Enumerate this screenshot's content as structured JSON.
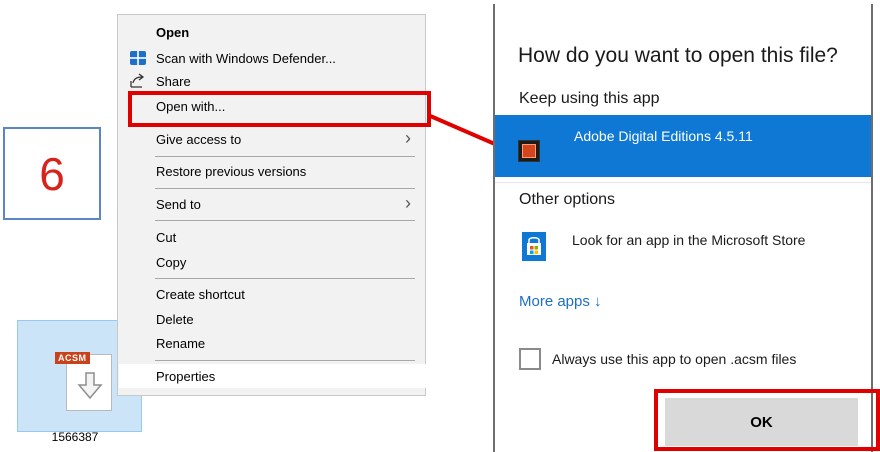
{
  "step": {
    "number": "6"
  },
  "file": {
    "badge": "ACSM",
    "name": "1566387"
  },
  "context_menu": {
    "items": [
      {
        "label": "Open",
        "icon": ""
      },
      {
        "label": "Scan with Windows Defender...",
        "icon": "windows-defender-icon"
      },
      {
        "label": "Share",
        "icon": "share-icon"
      },
      {
        "label": "Open with...",
        "icon": ""
      },
      {
        "label": "Give access to",
        "icon": ""
      },
      {
        "label": "Restore previous versions",
        "icon": ""
      },
      {
        "label": "Send to",
        "icon": ""
      },
      {
        "label": "Cut",
        "icon": ""
      },
      {
        "label": "Copy",
        "icon": ""
      },
      {
        "label": "Create shortcut",
        "icon": ""
      },
      {
        "label": "Delete",
        "icon": ""
      },
      {
        "label": "Rename",
        "icon": ""
      },
      {
        "label": "Properties",
        "icon": ""
      }
    ],
    "chevron": "›"
  },
  "dialog": {
    "title": "How do you want to open this file?",
    "keep_using": "Keep using this app",
    "selected_app": "Adobe Digital Editions 4.5.11",
    "other_options": "Other options",
    "store_option": "Look for an app in the Microsoft Store",
    "more_apps": "More apps ↓",
    "always_use": "Always use this app to open .acsm files",
    "ok": "OK"
  },
  "colors": {
    "highlight_red": "#e00000",
    "selection_blue": "#0f78d5",
    "link_blue": "#1c6fc6",
    "step_red": "#d8231c"
  }
}
